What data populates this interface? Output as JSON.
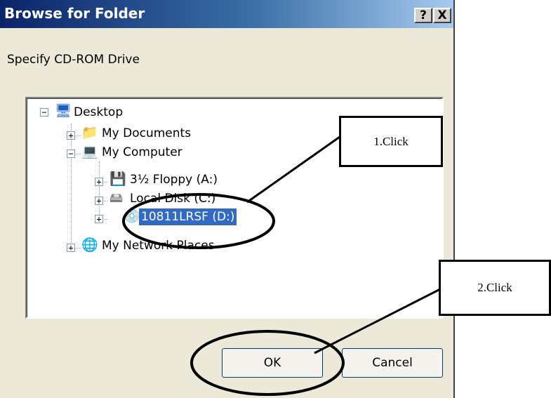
{
  "window": {
    "title": "Browse for Folder",
    "help_button": "?",
    "close_button": "X"
  },
  "prompt": "Specify CD-ROM Drive",
  "tree": [
    {
      "label": "Desktop",
      "icon": "desktop-icon",
      "expander": "−"
    },
    {
      "label": "My Documents",
      "icon": "folder-icon",
      "expander": "+"
    },
    {
      "label": "My Computer",
      "icon": "computer-icon",
      "expander": "−"
    },
    {
      "label": "3½ Floppy (A:)",
      "icon": "floppy-drive-icon",
      "expander": "+"
    },
    {
      "label": "Local Disk (C:)",
      "icon": "hard-disk-icon",
      "expander": "+"
    },
    {
      "label": "10811LRSF (D:)",
      "icon": "cd-drive-icon",
      "expander": "+",
      "selected": true
    },
    {
      "label": "My Network Places",
      "icon": "network-places-icon",
      "expander": "+"
    }
  ],
  "buttons": {
    "ok": "OK",
    "cancel": "Cancel"
  },
  "annotations": {
    "step1": "1.Click",
    "step2": "2.Click"
  }
}
